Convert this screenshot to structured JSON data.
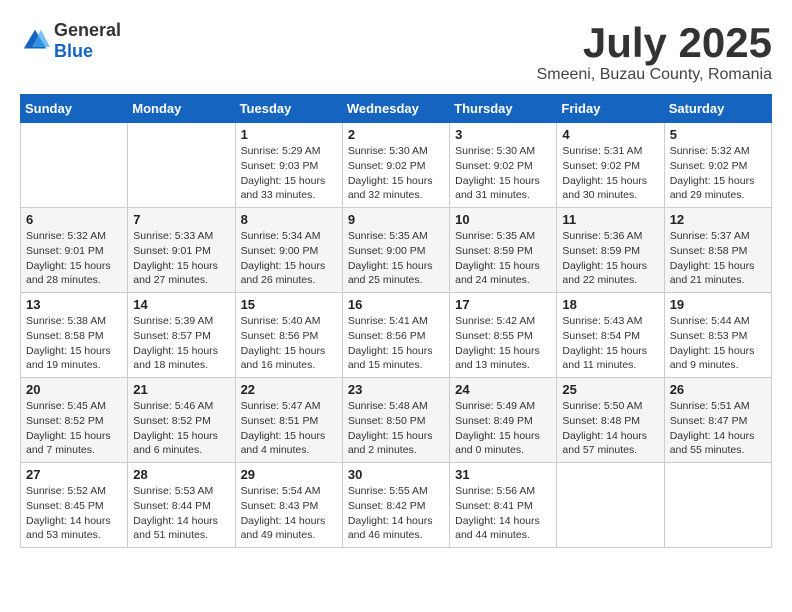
{
  "header": {
    "logo": {
      "general": "General",
      "blue": "Blue"
    },
    "title": "July 2025",
    "subtitle": "Smeeni, Buzau County, Romania"
  },
  "days_of_week": [
    "Sunday",
    "Monday",
    "Tuesday",
    "Wednesday",
    "Thursday",
    "Friday",
    "Saturday"
  ],
  "weeks": [
    [
      {
        "day": "",
        "info": ""
      },
      {
        "day": "",
        "info": ""
      },
      {
        "day": "1",
        "sunrise": "5:29 AM",
        "sunset": "9:03 PM",
        "daylight": "15 hours and 33 minutes."
      },
      {
        "day": "2",
        "sunrise": "5:30 AM",
        "sunset": "9:02 PM",
        "daylight": "15 hours and 32 minutes."
      },
      {
        "day": "3",
        "sunrise": "5:30 AM",
        "sunset": "9:02 PM",
        "daylight": "15 hours and 31 minutes."
      },
      {
        "day": "4",
        "sunrise": "5:31 AM",
        "sunset": "9:02 PM",
        "daylight": "15 hours and 30 minutes."
      },
      {
        "day": "5",
        "sunrise": "5:32 AM",
        "sunset": "9:02 PM",
        "daylight": "15 hours and 29 minutes."
      }
    ],
    [
      {
        "day": "6",
        "sunrise": "5:32 AM",
        "sunset": "9:01 PM",
        "daylight": "15 hours and 28 minutes."
      },
      {
        "day": "7",
        "sunrise": "5:33 AM",
        "sunset": "9:01 PM",
        "daylight": "15 hours and 27 minutes."
      },
      {
        "day": "8",
        "sunrise": "5:34 AM",
        "sunset": "9:00 PM",
        "daylight": "15 hours and 26 minutes."
      },
      {
        "day": "9",
        "sunrise": "5:35 AM",
        "sunset": "9:00 PM",
        "daylight": "15 hours and 25 minutes."
      },
      {
        "day": "10",
        "sunrise": "5:35 AM",
        "sunset": "8:59 PM",
        "daylight": "15 hours and 24 minutes."
      },
      {
        "day": "11",
        "sunrise": "5:36 AM",
        "sunset": "8:59 PM",
        "daylight": "15 hours and 22 minutes."
      },
      {
        "day": "12",
        "sunrise": "5:37 AM",
        "sunset": "8:58 PM",
        "daylight": "15 hours and 21 minutes."
      }
    ],
    [
      {
        "day": "13",
        "sunrise": "5:38 AM",
        "sunset": "8:58 PM",
        "daylight": "15 hours and 19 minutes."
      },
      {
        "day": "14",
        "sunrise": "5:39 AM",
        "sunset": "8:57 PM",
        "daylight": "15 hours and 18 minutes."
      },
      {
        "day": "15",
        "sunrise": "5:40 AM",
        "sunset": "8:56 PM",
        "daylight": "15 hours and 16 minutes."
      },
      {
        "day": "16",
        "sunrise": "5:41 AM",
        "sunset": "8:56 PM",
        "daylight": "15 hours and 15 minutes."
      },
      {
        "day": "17",
        "sunrise": "5:42 AM",
        "sunset": "8:55 PM",
        "daylight": "15 hours and 13 minutes."
      },
      {
        "day": "18",
        "sunrise": "5:43 AM",
        "sunset": "8:54 PM",
        "daylight": "15 hours and 11 minutes."
      },
      {
        "day": "19",
        "sunrise": "5:44 AM",
        "sunset": "8:53 PM",
        "daylight": "15 hours and 9 minutes."
      }
    ],
    [
      {
        "day": "20",
        "sunrise": "5:45 AM",
        "sunset": "8:52 PM",
        "daylight": "15 hours and 7 minutes."
      },
      {
        "day": "21",
        "sunrise": "5:46 AM",
        "sunset": "8:52 PM",
        "daylight": "15 hours and 6 minutes."
      },
      {
        "day": "22",
        "sunrise": "5:47 AM",
        "sunset": "8:51 PM",
        "daylight": "15 hours and 4 minutes."
      },
      {
        "day": "23",
        "sunrise": "5:48 AM",
        "sunset": "8:50 PM",
        "daylight": "15 hours and 2 minutes."
      },
      {
        "day": "24",
        "sunrise": "5:49 AM",
        "sunset": "8:49 PM",
        "daylight": "15 hours and 0 minutes."
      },
      {
        "day": "25",
        "sunrise": "5:50 AM",
        "sunset": "8:48 PM",
        "daylight": "14 hours and 57 minutes."
      },
      {
        "day": "26",
        "sunrise": "5:51 AM",
        "sunset": "8:47 PM",
        "daylight": "14 hours and 55 minutes."
      }
    ],
    [
      {
        "day": "27",
        "sunrise": "5:52 AM",
        "sunset": "8:45 PM",
        "daylight": "14 hours and 53 minutes."
      },
      {
        "day": "28",
        "sunrise": "5:53 AM",
        "sunset": "8:44 PM",
        "daylight": "14 hours and 51 minutes."
      },
      {
        "day": "29",
        "sunrise": "5:54 AM",
        "sunset": "8:43 PM",
        "daylight": "14 hours and 49 minutes."
      },
      {
        "day": "30",
        "sunrise": "5:55 AM",
        "sunset": "8:42 PM",
        "daylight": "14 hours and 46 minutes."
      },
      {
        "day": "31",
        "sunrise": "5:56 AM",
        "sunset": "8:41 PM",
        "daylight": "14 hours and 44 minutes."
      },
      {
        "day": "",
        "info": ""
      },
      {
        "day": "",
        "info": ""
      }
    ]
  ]
}
